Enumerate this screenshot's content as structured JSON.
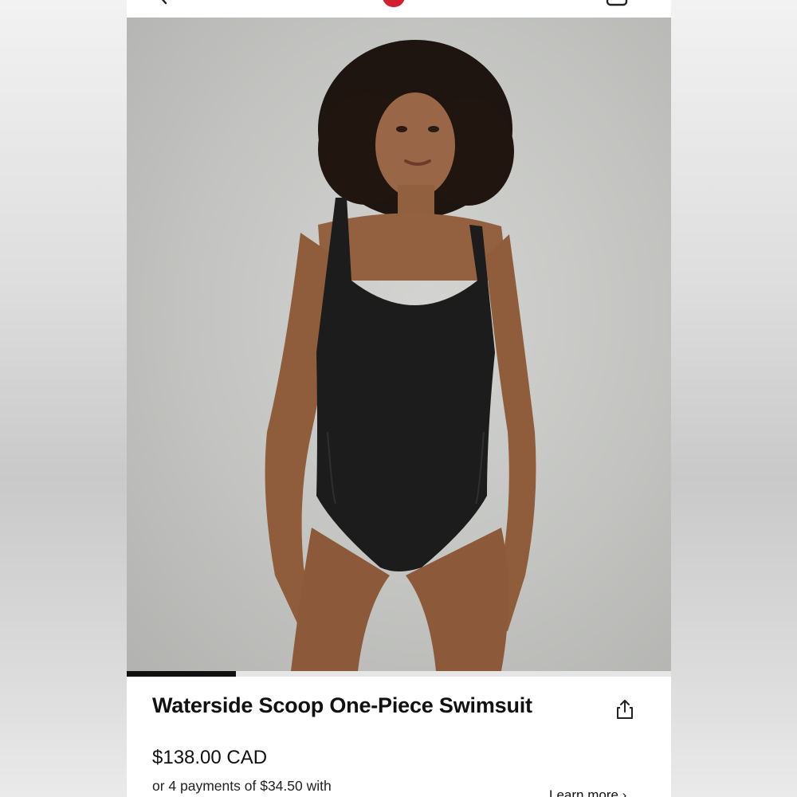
{
  "product": {
    "title": "Waterside Scoop One-Piece Swimsuit",
    "price": "$138.00 CAD",
    "installments": "or 4 payments of $34.50 with",
    "learn_more": "Learn more ›"
  },
  "carousel": {
    "current_slide_fraction": 0.2
  },
  "colors": {
    "brand_red": "#d22030",
    "text": "#111111",
    "indicator": "#111111"
  },
  "icons": {
    "back": "chevron-left-icon",
    "logo": "lululemon-logo",
    "bag": "shopping-bag-icon",
    "share": "share-icon"
  }
}
